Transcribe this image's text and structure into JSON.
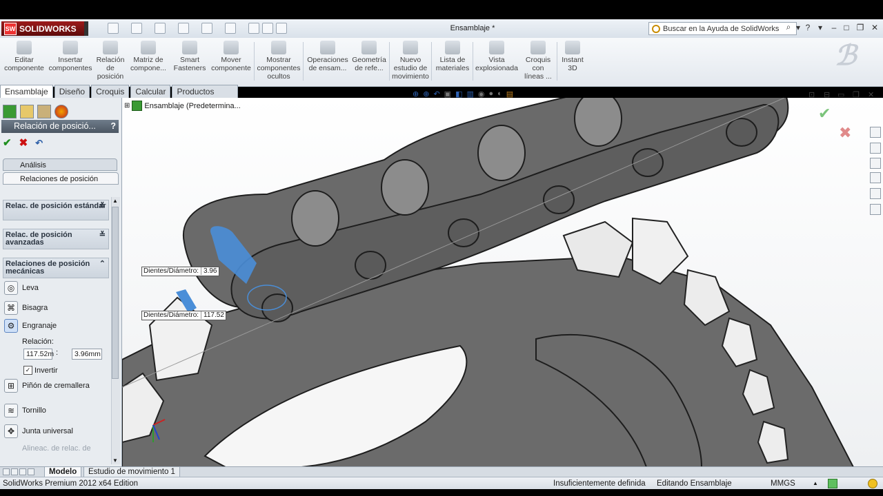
{
  "app": {
    "logo_text": "SOLIDWORKS",
    "document_title": "Ensamblaje *",
    "search_placeholder": "Buscar en la Ayuda de SolidWorks"
  },
  "command_manager": {
    "items": [
      {
        "label_lines": [
          "Editar",
          "componente"
        ]
      },
      {
        "label_lines": [
          "Insertar",
          "componentes"
        ]
      },
      {
        "label_lines": [
          "Relación",
          "de",
          "posición"
        ]
      },
      {
        "label_lines": [
          "Matriz de",
          "compone..."
        ]
      },
      {
        "label_lines": [
          "Smart",
          "Fasteners"
        ]
      },
      {
        "label_lines": [
          "Mover",
          "componente"
        ]
      },
      {
        "label_lines": [
          "Mostrar",
          "componentes",
          "ocultos"
        ]
      },
      {
        "label_lines": [
          "Operaciones",
          "de ensam..."
        ]
      },
      {
        "label_lines": [
          "Geometría",
          "de refe..."
        ]
      },
      {
        "label_lines": [
          "Nuevo",
          "estudio de",
          "movimiento"
        ]
      },
      {
        "label_lines": [
          "Lista de",
          "materiales"
        ]
      },
      {
        "label_lines": [
          "Vista",
          "explosionada"
        ]
      },
      {
        "label_lines": [
          "Croquis",
          "con",
          "líneas ..."
        ]
      },
      {
        "label_lines": [
          "Instant",
          "3D"
        ]
      }
    ]
  },
  "tabs": [
    "Ensamblaje",
    "Diseño",
    "Croquis",
    "Calcular",
    "Productos Office"
  ],
  "property_manager": {
    "title": "Relación de posició...",
    "help": "?",
    "subtabs": [
      "Análisis",
      "Relaciones de posición"
    ],
    "groups": [
      {
        "label": "Relac. de posición estándar"
      },
      {
        "label": "Relac. de posición avanzadas"
      },
      {
        "label": "Relaciones de posición mecánicas"
      }
    ],
    "mates": [
      {
        "label": "Leva"
      },
      {
        "label": "Bisagra"
      },
      {
        "label": "Engranaje"
      },
      {
        "label": "Piñón de cremallera"
      },
      {
        "label": "Tornillo"
      },
      {
        "label": "Junta universal"
      }
    ],
    "ratio_label": "Relación:",
    "ratio_left": "117.52m",
    "ratio_sep": ":",
    "ratio_right": "3.96mm",
    "invert_label": "Invertir",
    "faded_item": "Alineac. de relac. de"
  },
  "viewport": {
    "tree_root": "Ensamblaje  (Predetermina...",
    "dim1_label": "Dientes/Diámetro:",
    "dim1_value": "3.96",
    "dim2_label": "Dientes/Diámetro:",
    "dim2_value": "117.52"
  },
  "bottom_tabs": [
    "Modelo",
    "Estudio de movimiento 1"
  ],
  "status": {
    "app_edition": "SolidWorks Premium 2012 x64 Edition",
    "definition": "Insuficientemente definida",
    "mode": "Editando Ensamblaje",
    "units": "MMGS",
    "units_arrow": "▲"
  },
  "colors": {
    "selection": "#4a8ed8",
    "ok_green": "#1f8f1f",
    "cancel_red": "#cc1111",
    "part_gray": "#6b6b6b"
  }
}
